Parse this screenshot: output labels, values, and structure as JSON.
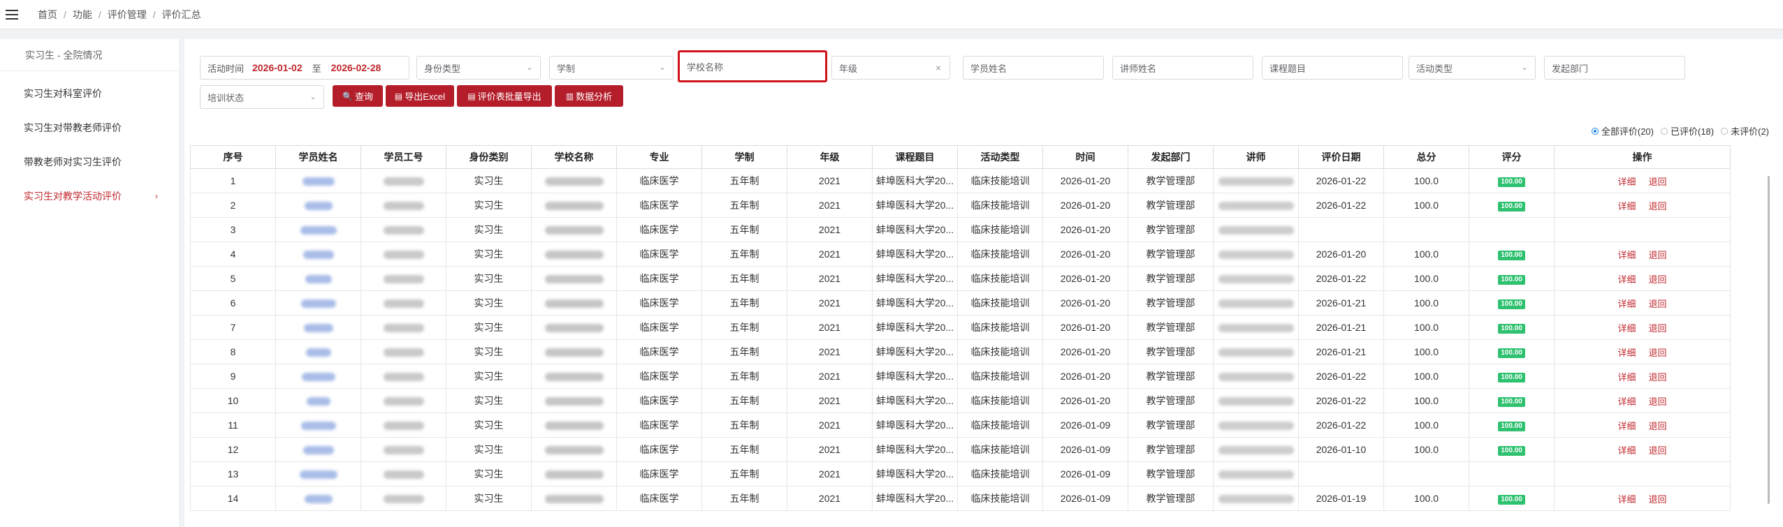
{
  "breadcrumb": [
    "首页",
    "功能",
    "评价管理",
    "评价汇总"
  ],
  "sidebar": {
    "header": "实习生 - 全院情况",
    "items": [
      {
        "label": "实习生对科室评价",
        "active": false
      },
      {
        "label": "实习生对带教老师评价",
        "active": false
      },
      {
        "label": "带教老师对实习生评价",
        "active": false
      },
      {
        "label": "实习生对教学活动评价",
        "active": true
      }
    ]
  },
  "filters": {
    "date_label": "活动时间",
    "date_start": "2026-01-02",
    "date_sep": "至",
    "date_end": "2026-02-28",
    "identity_ph": "身份类型",
    "schooling_ph": "学制",
    "school_ph": "学校名称",
    "grade_ph": "年级",
    "student_ph": "学员姓名",
    "lecturer_ph": "讲师姓名",
    "course_ph": "课程题目",
    "activity_ph": "活动类型",
    "dept_ph": "发起部门",
    "training_ph": "培训状态"
  },
  "buttons": {
    "query": "查询",
    "export_excel": "导出Excel",
    "export_batch": "评价表批量导出",
    "analysis": "数据分析"
  },
  "radios": [
    {
      "label": "全部评价(20)",
      "checked": true
    },
    {
      "label": "已评价(18)",
      "checked": false
    },
    {
      "label": "未评价(2)",
      "checked": false
    }
  ],
  "table": {
    "headers": [
      "序号",
      "学员姓名",
      "学员工号",
      "身份类别",
      "学校名称",
      "专业",
      "学制",
      "年级",
      "课程题目",
      "活动类型",
      "时间",
      "发起部门",
      "讲师",
      "评价日期",
      "总分",
      "评分",
      "操作"
    ],
    "action_detail": "详细",
    "action_return": "退回",
    "rows": [
      {
        "no": "1",
        "identity": "实习生",
        "major": "临床医学",
        "schooling": "五年制",
        "grade": "2021",
        "course": "蚌埠医科大学20...",
        "activity": "临床技能培训",
        "time": "2026-01-20",
        "dept": "教学管理部",
        "eval_date": "2026-01-22",
        "total": "100.0",
        "score": "100.00"
      },
      {
        "no": "2",
        "identity": "实习生",
        "major": "临床医学",
        "schooling": "五年制",
        "grade": "2021",
        "course": "蚌埠医科大学20...",
        "activity": "临床技能培训",
        "time": "2026-01-20",
        "dept": "教学管理部",
        "eval_date": "2026-01-22",
        "total": "100.0",
        "score": "100.00"
      },
      {
        "no": "3",
        "identity": "实习生",
        "major": "临床医学",
        "schooling": "五年制",
        "grade": "2021",
        "course": "蚌埠医科大学20...",
        "activity": "临床技能培训",
        "time": "2026-01-20",
        "dept": "教学管理部",
        "eval_date": "",
        "total": "",
        "score": ""
      },
      {
        "no": "4",
        "identity": "实习生",
        "major": "临床医学",
        "schooling": "五年制",
        "grade": "2021",
        "course": "蚌埠医科大学20...",
        "activity": "临床技能培训",
        "time": "2026-01-20",
        "dept": "教学管理部",
        "eval_date": "2026-01-20",
        "total": "100.0",
        "score": "100.00"
      },
      {
        "no": "5",
        "identity": "实习生",
        "major": "临床医学",
        "schooling": "五年制",
        "grade": "2021",
        "course": "蚌埠医科大学20...",
        "activity": "临床技能培训",
        "time": "2026-01-20",
        "dept": "教学管理部",
        "eval_date": "2026-01-22",
        "total": "100.0",
        "score": "100.00"
      },
      {
        "no": "6",
        "identity": "实习生",
        "major": "临床医学",
        "schooling": "五年制",
        "grade": "2021",
        "course": "蚌埠医科大学20...",
        "activity": "临床技能培训",
        "time": "2026-01-20",
        "dept": "教学管理部",
        "eval_date": "2026-01-21",
        "total": "100.0",
        "score": "100.00"
      },
      {
        "no": "7",
        "identity": "实习生",
        "major": "临床医学",
        "schooling": "五年制",
        "grade": "2021",
        "course": "蚌埠医科大学20...",
        "activity": "临床技能培训",
        "time": "2026-01-20",
        "dept": "教学管理部",
        "eval_date": "2026-01-21",
        "total": "100.0",
        "score": "100.00"
      },
      {
        "no": "8",
        "identity": "实习生",
        "major": "临床医学",
        "schooling": "五年制",
        "grade": "2021",
        "course": "蚌埠医科大学20...",
        "activity": "临床技能培训",
        "time": "2026-01-20",
        "dept": "教学管理部",
        "eval_date": "2026-01-21",
        "total": "100.0",
        "score": "100.00"
      },
      {
        "no": "9",
        "identity": "实习生",
        "major": "临床医学",
        "schooling": "五年制",
        "grade": "2021",
        "course": "蚌埠医科大学20...",
        "activity": "临床技能培训",
        "time": "2026-01-20",
        "dept": "教学管理部",
        "eval_date": "2026-01-22",
        "total": "100.0",
        "score": "100.00"
      },
      {
        "no": "10",
        "identity": "实习生",
        "major": "临床医学",
        "schooling": "五年制",
        "grade": "2021",
        "course": "蚌埠医科大学20...",
        "activity": "临床技能培训",
        "time": "2026-01-20",
        "dept": "教学管理部",
        "eval_date": "2026-01-22",
        "total": "100.0",
        "score": "100.00"
      },
      {
        "no": "11",
        "identity": "实习生",
        "major": "临床医学",
        "schooling": "五年制",
        "grade": "2021",
        "course": "蚌埠医科大学20...",
        "activity": "临床技能培训",
        "time": "2026-01-09",
        "dept": "教学管理部",
        "eval_date": "2026-01-22",
        "total": "100.0",
        "score": "100.00"
      },
      {
        "no": "12",
        "identity": "实习生",
        "major": "临床医学",
        "schooling": "五年制",
        "grade": "2021",
        "course": "蚌埠医科大学20...",
        "activity": "临床技能培训",
        "time": "2026-01-09",
        "dept": "教学管理部",
        "eval_date": "2026-01-10",
        "total": "100.0",
        "score": "100.00"
      },
      {
        "no": "13",
        "identity": "实习生",
        "major": "临床医学",
        "schooling": "五年制",
        "grade": "2021",
        "course": "蚌埠医科大学20...",
        "activity": "临床技能培训",
        "time": "2026-01-09",
        "dept": "教学管理部",
        "eval_date": "",
        "total": "",
        "score": ""
      },
      {
        "no": "14",
        "identity": "实习生",
        "major": "临床医学",
        "schooling": "五年制",
        "grade": "2021",
        "course": "蚌埠医科大学20...",
        "activity": "临床技能培训",
        "time": "2026-01-09",
        "dept": "教学管理部",
        "eval_date": "2026-01-19",
        "total": "100.0",
        "score": "100.00"
      }
    ]
  }
}
